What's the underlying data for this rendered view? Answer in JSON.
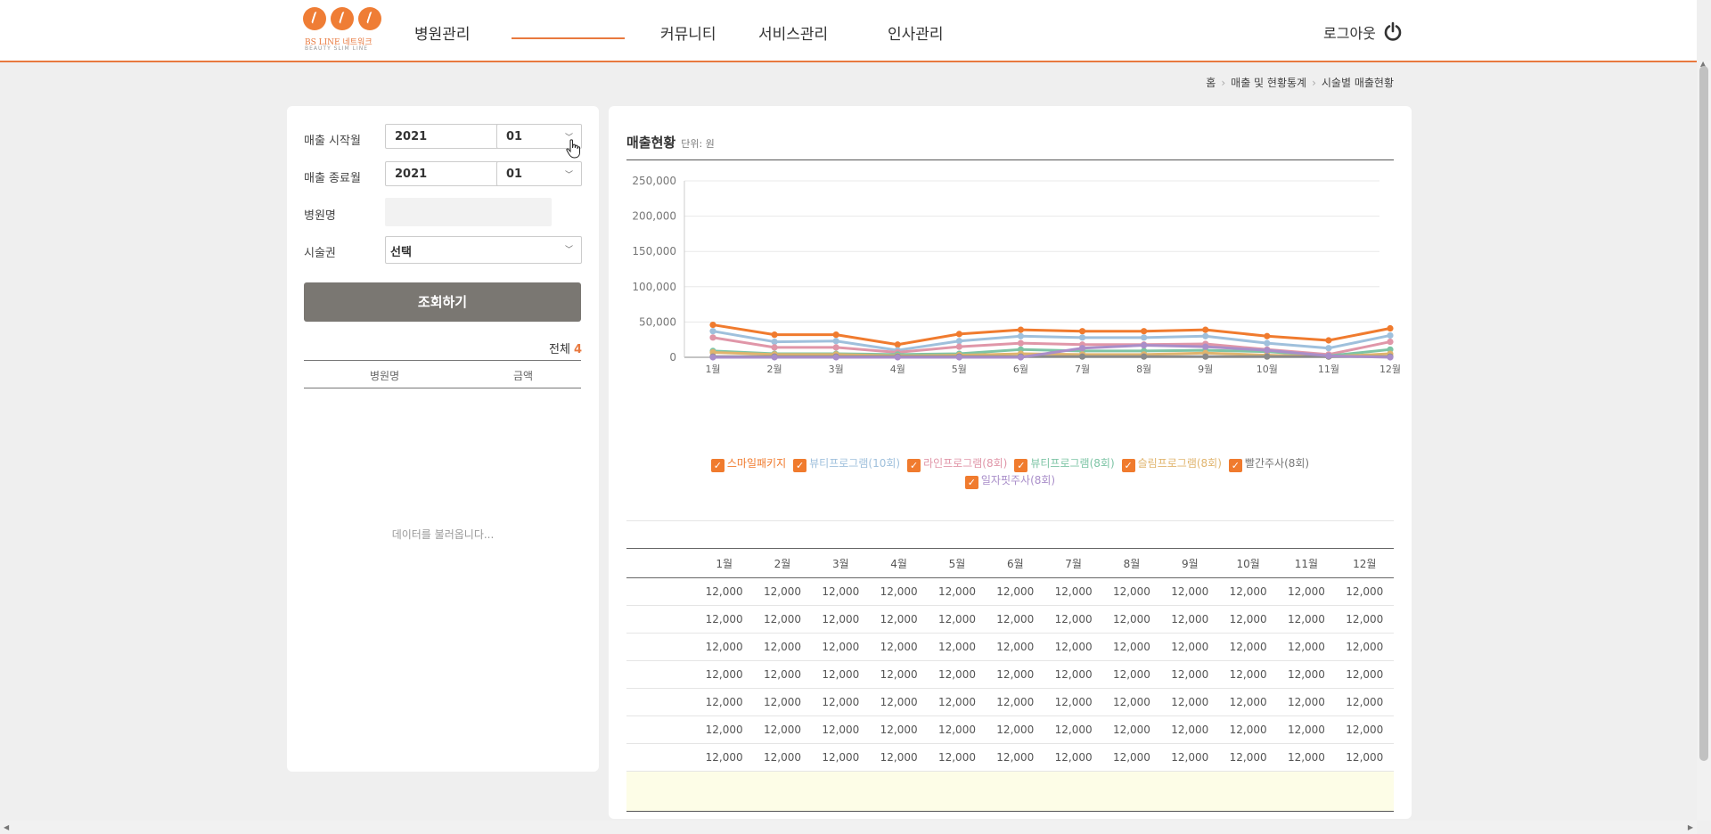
{
  "header": {
    "brand": "BS LINE 네트워크",
    "brand_sub": "BEAUTY SLIM LINE",
    "nav": [
      "병원관리",
      "",
      "커뮤니티",
      "서비스관리",
      "인사관리"
    ],
    "logout": "로그아웃"
  },
  "breadcrumb": [
    "홈",
    "매출 및 현황통계",
    "시술별 매출현황"
  ],
  "filter": {
    "start_label": "매출 시작월",
    "start_year": "2021",
    "start_month": "01",
    "end_label": "매출 종료월",
    "end_year": "2021",
    "end_month": "01",
    "hospital_label": "병원명",
    "hospital_value": "",
    "ticket_label": "시술권",
    "ticket_value": "선택",
    "search_button": "조회하기",
    "total_label": "전체",
    "total_count": "4",
    "columns": [
      "병원명",
      "금액"
    ],
    "loading": "데이터를 불러옵니다..."
  },
  "chart_panel": {
    "title": "매출현황",
    "unit": "단위: 원"
  },
  "chart_data": {
    "type": "line",
    "categories": [
      "1월",
      "2월",
      "3월",
      "4월",
      "5월",
      "6월",
      "7월",
      "8월",
      "9월",
      "10월",
      "11월",
      "12월"
    ],
    "ylim": [
      0,
      250000
    ],
    "yticks": [
      0,
      50000,
      100000,
      150000,
      200000,
      250000
    ],
    "ytick_labels": [
      "0",
      "50,000",
      "100,000",
      "150,000",
      "200,000",
      "250,000"
    ],
    "grid": true,
    "legend_position": "bottom",
    "series": [
      {
        "name": "스마일패키지",
        "color": "#f07b2e",
        "values": [
          46000,
          32000,
          32000,
          18000,
          33000,
          39000,
          37000,
          37000,
          39000,
          30000,
          24000,
          41000
        ]
      },
      {
        "name": "뷰티프로그램(10회)",
        "color": "#9fc0dc",
        "values": [
          37000,
          22000,
          23000,
          10000,
          23000,
          30000,
          28000,
          28000,
          30000,
          20000,
          13000,
          31000
        ]
      },
      {
        "name": "라인프로그램(8회)",
        "color": "#e096a8",
        "values": [
          28000,
          14000,
          14000,
          7000,
          15000,
          20000,
          18000,
          18000,
          19000,
          11000,
          4000,
          22000
        ]
      },
      {
        "name": "뷰티프로그램(8회)",
        "color": "#7dc4a5",
        "values": [
          9000,
          5000,
          5000,
          4000,
          5000,
          11000,
          9000,
          9000,
          10000,
          8000,
          2000,
          11000
        ]
      },
      {
        "name": "슬림프로그램(8회)",
        "color": "#e0b46d",
        "values": [
          7000,
          4000,
          4000,
          2000,
          3000,
          5000,
          4000,
          4000,
          6000,
          3000,
          1000,
          5000
        ]
      },
      {
        "name": "빨간주사(8회)",
        "color": "#8a8a8a",
        "values": [
          1000,
          1000,
          1000,
          1000,
          1000,
          1000,
          1000,
          1000,
          1000,
          1000,
          1000,
          1000
        ]
      },
      {
        "name": "일자핏주사(8회)",
        "color": "#a98ec9",
        "values": [
          0,
          0,
          0,
          0,
          0,
          0,
          13000,
          17000,
          15000,
          10000,
          2000,
          0
        ]
      }
    ]
  },
  "table": {
    "headers": [
      "1월",
      "2월",
      "3월",
      "4월",
      "5월",
      "6월",
      "7월",
      "8월",
      "9월",
      "10월",
      "11월",
      "12월"
    ],
    "rows": [
      [
        "",
        "12,000",
        "12,000",
        "12,000",
        "12,000",
        "12,000",
        "12,000",
        "12,000",
        "12,000",
        "12,000",
        "12,000",
        "12,000",
        "12,000"
      ],
      [
        "",
        "12,000",
        "12,000",
        "12,000",
        "12,000",
        "12,000",
        "12,000",
        "12,000",
        "12,000",
        "12,000",
        "12,000",
        "12,000",
        "12,000"
      ],
      [
        "",
        "12,000",
        "12,000",
        "12,000",
        "12,000",
        "12,000",
        "12,000",
        "12,000",
        "12,000",
        "12,000",
        "12,000",
        "12,000",
        "12,000"
      ],
      [
        "",
        "12,000",
        "12,000",
        "12,000",
        "12,000",
        "12,000",
        "12,000",
        "12,000",
        "12,000",
        "12,000",
        "12,000",
        "12,000",
        "12,000"
      ],
      [
        "",
        "12,000",
        "12,000",
        "12,000",
        "12,000",
        "12,000",
        "12,000",
        "12,000",
        "12,000",
        "12,000",
        "12,000",
        "12,000",
        "12,000"
      ],
      [
        "",
        "12,000",
        "12,000",
        "12,000",
        "12,000",
        "12,000",
        "12,000",
        "12,000",
        "12,000",
        "12,000",
        "12,000",
        "12,000",
        "12,000"
      ],
      [
        "",
        "12,000",
        "12,000",
        "12,000",
        "12,000",
        "12,000",
        "12,000",
        "12,000",
        "12,000",
        "12,000",
        "12,000",
        "12,000",
        "12,000"
      ]
    ]
  }
}
